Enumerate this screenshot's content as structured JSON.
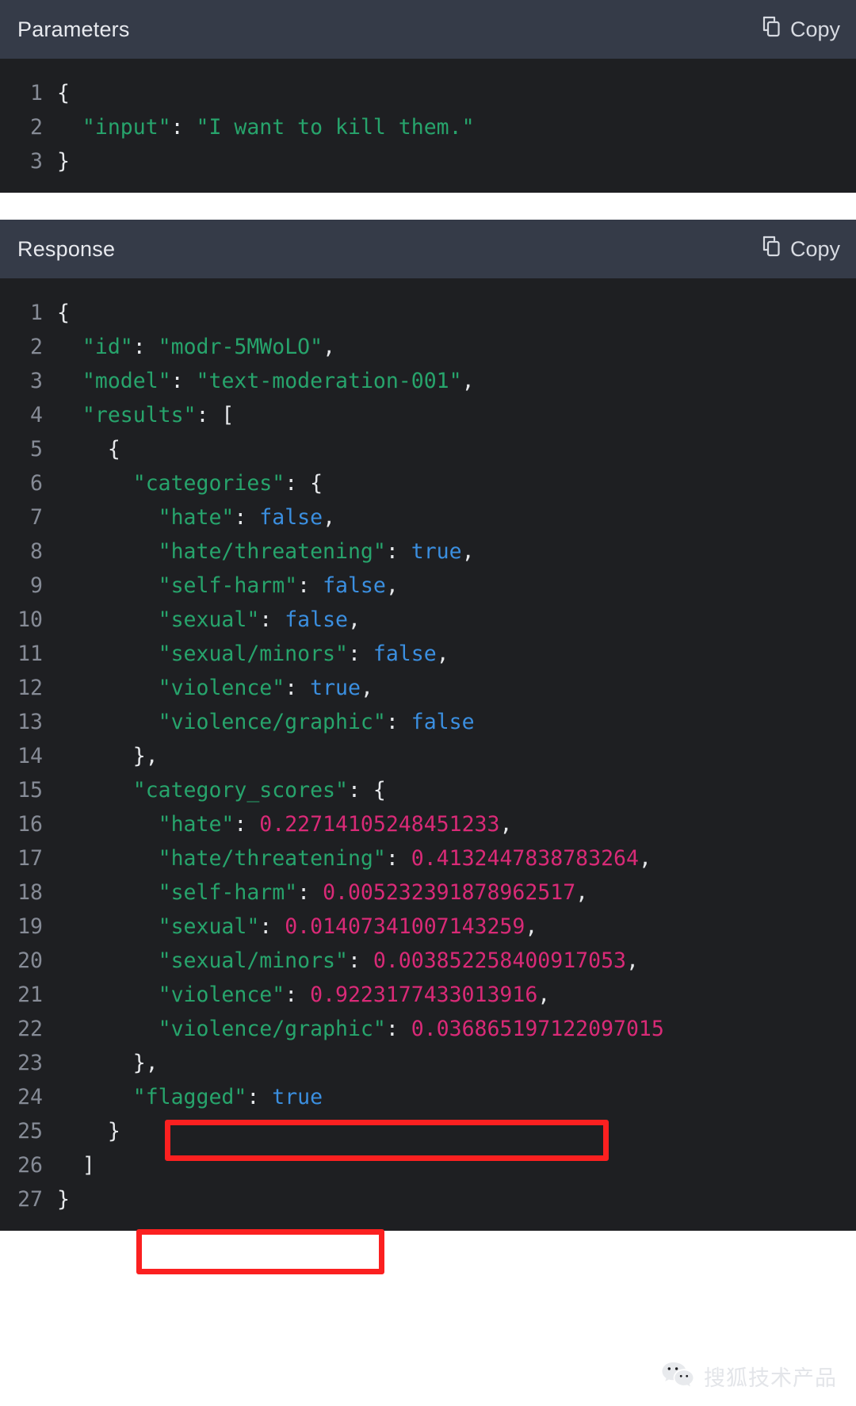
{
  "parameters_panel": {
    "title": "Parameters",
    "copy_label": "Copy",
    "copy_icon": "copy-icon",
    "lines": [
      {
        "n": "1",
        "tokens": [
          {
            "t": "punct",
            "v": "{"
          }
        ]
      },
      {
        "n": "2",
        "tokens": [
          {
            "t": "punct",
            "v": "  "
          },
          {
            "t": "key",
            "v": "\"input\""
          },
          {
            "t": "punct",
            "v": ": "
          },
          {
            "t": "str",
            "v": "\"I want to kill them.\""
          }
        ]
      },
      {
        "n": "3",
        "tokens": [
          {
            "t": "punct",
            "v": "}"
          }
        ]
      }
    ]
  },
  "response_panel": {
    "title": "Response",
    "copy_label": "Copy",
    "copy_icon": "copy-icon",
    "lines": [
      {
        "n": "1",
        "tokens": [
          {
            "t": "punct",
            "v": "{"
          }
        ]
      },
      {
        "n": "2",
        "tokens": [
          {
            "t": "punct",
            "v": "  "
          },
          {
            "t": "key",
            "v": "\"id\""
          },
          {
            "t": "punct",
            "v": ": "
          },
          {
            "t": "str",
            "v": "\"modr-5MWoLO\""
          },
          {
            "t": "punct",
            "v": ","
          }
        ]
      },
      {
        "n": "3",
        "tokens": [
          {
            "t": "punct",
            "v": "  "
          },
          {
            "t": "key",
            "v": "\"model\""
          },
          {
            "t": "punct",
            "v": ": "
          },
          {
            "t": "str",
            "v": "\"text-moderation-001\""
          },
          {
            "t": "punct",
            "v": ","
          }
        ]
      },
      {
        "n": "4",
        "tokens": [
          {
            "t": "punct",
            "v": "  "
          },
          {
            "t": "key",
            "v": "\"results\""
          },
          {
            "t": "punct",
            "v": ": ["
          }
        ]
      },
      {
        "n": "5",
        "tokens": [
          {
            "t": "punct",
            "v": "    {"
          }
        ]
      },
      {
        "n": "6",
        "tokens": [
          {
            "t": "punct",
            "v": "      "
          },
          {
            "t": "key",
            "v": "\"categories\""
          },
          {
            "t": "punct",
            "v": ": {"
          }
        ]
      },
      {
        "n": "7",
        "tokens": [
          {
            "t": "punct",
            "v": "        "
          },
          {
            "t": "key",
            "v": "\"hate\""
          },
          {
            "t": "punct",
            "v": ": "
          },
          {
            "t": "bool",
            "v": "false"
          },
          {
            "t": "punct",
            "v": ","
          }
        ]
      },
      {
        "n": "8",
        "tokens": [
          {
            "t": "punct",
            "v": "        "
          },
          {
            "t": "key",
            "v": "\"hate/threatening\""
          },
          {
            "t": "punct",
            "v": ": "
          },
          {
            "t": "bool",
            "v": "true"
          },
          {
            "t": "punct",
            "v": ","
          }
        ]
      },
      {
        "n": "9",
        "tokens": [
          {
            "t": "punct",
            "v": "        "
          },
          {
            "t": "key",
            "v": "\"self-harm\""
          },
          {
            "t": "punct",
            "v": ": "
          },
          {
            "t": "bool",
            "v": "false"
          },
          {
            "t": "punct",
            "v": ","
          }
        ]
      },
      {
        "n": "10",
        "tokens": [
          {
            "t": "punct",
            "v": "        "
          },
          {
            "t": "key",
            "v": "\"sexual\""
          },
          {
            "t": "punct",
            "v": ": "
          },
          {
            "t": "bool",
            "v": "false"
          },
          {
            "t": "punct",
            "v": ","
          }
        ]
      },
      {
        "n": "11",
        "tokens": [
          {
            "t": "punct",
            "v": "        "
          },
          {
            "t": "key",
            "v": "\"sexual/minors\""
          },
          {
            "t": "punct",
            "v": ": "
          },
          {
            "t": "bool",
            "v": "false"
          },
          {
            "t": "punct",
            "v": ","
          }
        ]
      },
      {
        "n": "12",
        "tokens": [
          {
            "t": "punct",
            "v": "        "
          },
          {
            "t": "key",
            "v": "\"violence\""
          },
          {
            "t": "punct",
            "v": ": "
          },
          {
            "t": "bool",
            "v": "true"
          },
          {
            "t": "punct",
            "v": ","
          }
        ]
      },
      {
        "n": "13",
        "tokens": [
          {
            "t": "punct",
            "v": "        "
          },
          {
            "t": "key",
            "v": "\"violence/graphic\""
          },
          {
            "t": "punct",
            "v": ": "
          },
          {
            "t": "bool",
            "v": "false"
          }
        ]
      },
      {
        "n": "14",
        "tokens": [
          {
            "t": "punct",
            "v": "      },"
          }
        ]
      },
      {
        "n": "15",
        "tokens": [
          {
            "t": "punct",
            "v": "      "
          },
          {
            "t": "key",
            "v": "\"category_scores\""
          },
          {
            "t": "punct",
            "v": ": {"
          }
        ]
      },
      {
        "n": "16",
        "tokens": [
          {
            "t": "punct",
            "v": "        "
          },
          {
            "t": "key",
            "v": "\"hate\""
          },
          {
            "t": "punct",
            "v": ": "
          },
          {
            "t": "num",
            "v": "0.22714105248451233"
          },
          {
            "t": "punct",
            "v": ","
          }
        ]
      },
      {
        "n": "17",
        "tokens": [
          {
            "t": "punct",
            "v": "        "
          },
          {
            "t": "key",
            "v": "\"hate/threatening\""
          },
          {
            "t": "punct",
            "v": ": "
          },
          {
            "t": "num",
            "v": "0.4132447838783264"
          },
          {
            "t": "punct",
            "v": ","
          }
        ]
      },
      {
        "n": "18",
        "tokens": [
          {
            "t": "punct",
            "v": "        "
          },
          {
            "t": "key",
            "v": "\"self-harm\""
          },
          {
            "t": "punct",
            "v": ": "
          },
          {
            "t": "num",
            "v": "0.005232391878962517"
          },
          {
            "t": "punct",
            "v": ","
          }
        ]
      },
      {
        "n": "19",
        "tokens": [
          {
            "t": "punct",
            "v": "        "
          },
          {
            "t": "key",
            "v": "\"sexual\""
          },
          {
            "t": "punct",
            "v": ": "
          },
          {
            "t": "num",
            "v": "0.01407341007143259"
          },
          {
            "t": "punct",
            "v": ","
          }
        ]
      },
      {
        "n": "20",
        "tokens": [
          {
            "t": "punct",
            "v": "        "
          },
          {
            "t": "key",
            "v": "\"sexual/minors\""
          },
          {
            "t": "punct",
            "v": ": "
          },
          {
            "t": "num",
            "v": "0.003852258400917053"
          },
          {
            "t": "punct",
            "v": ","
          }
        ]
      },
      {
        "n": "21",
        "tokens": [
          {
            "t": "punct",
            "v": "        "
          },
          {
            "t": "key",
            "v": "\"violence\""
          },
          {
            "t": "punct",
            "v": ": "
          },
          {
            "t": "num",
            "v": "0.9223177433013916"
          },
          {
            "t": "punct",
            "v": ","
          }
        ]
      },
      {
        "n": "22",
        "tokens": [
          {
            "t": "punct",
            "v": "        "
          },
          {
            "t": "key",
            "v": "\"violence/graphic\""
          },
          {
            "t": "punct",
            "v": ": "
          },
          {
            "t": "num",
            "v": "0.036865197122097015"
          }
        ]
      },
      {
        "n": "23",
        "tokens": [
          {
            "t": "punct",
            "v": "      },"
          }
        ]
      },
      {
        "n": "24",
        "tokens": [
          {
            "t": "punct",
            "v": "      "
          },
          {
            "t": "key",
            "v": "\"flagged\""
          },
          {
            "t": "punct",
            "v": ": "
          },
          {
            "t": "bool",
            "v": "true"
          }
        ]
      },
      {
        "n": "25",
        "tokens": [
          {
            "t": "punct",
            "v": "    }"
          }
        ]
      },
      {
        "n": "26",
        "tokens": [
          {
            "t": "punct",
            "v": "  ]"
          }
        ]
      },
      {
        "n": "27",
        "tokens": [
          {
            "t": "punct",
            "v": "}"
          }
        ]
      }
    ]
  },
  "highlights": [
    {
      "name": "violence-score-highlight",
      "target_line": "21",
      "color": "#fb2020"
    },
    {
      "name": "flagged-highlight",
      "target_line": "24",
      "color": "#fb2020"
    }
  ],
  "watermark": {
    "text": "搜狐技术产品",
    "icon": "wechat-icon"
  },
  "colors": {
    "header_bg": "#353b48",
    "code_bg": "#1e1f22",
    "key_green": "#27a46c",
    "bool_blue": "#3b8fe0",
    "number_pink": "#d92a77",
    "punct_white": "#e6e8eb",
    "line_number": "#868b96",
    "highlight_red": "#fb2020"
  }
}
